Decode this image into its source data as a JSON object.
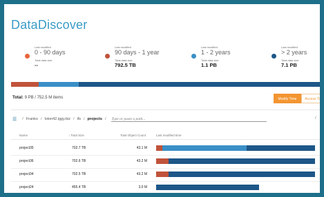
{
  "app": {
    "title": "DataDiscover"
  },
  "colors": {
    "age_0_90": "#e9653b",
    "age_90_1y": "#c0533b",
    "age_1_2y": "#3a8fc7",
    "age_gt2y": "#1d5688",
    "accent": "#f39531"
  },
  "stats": [
    {
      "caption": "Last modified",
      "range": "0 - 90 days",
      "size_caption": "Total data size",
      "size": "--"
    },
    {
      "caption": "Last modified",
      "range": "90 days - 1 year",
      "size_caption": "Total data size",
      "size": "792.5 TB"
    },
    {
      "caption": "Last modified",
      "range": "1 - 2 years",
      "size_caption": "Total data size",
      "size": "1.1 PB"
    },
    {
      "caption": "Last modified",
      "range": "> 2 years",
      "size_caption": "Total data size",
      "size": "7.1 PB"
    }
  ],
  "overall_distribution": [
    0.087,
    0.126,
    0.787
  ],
  "summary": {
    "total_label": "Total:",
    "total_value": "9 PB / 752.5 M items"
  },
  "toggle": {
    "modify_time": "Modify Time",
    "access_time": "Access Time"
  },
  "breadcrumb": {
    "items": [
      "Franko",
      "lolon42.iggy.biz",
      "ifs",
      "projects"
    ],
    "separator": "/",
    "path_placeholder": "Type or paste a path...",
    "trailing_slash": "/",
    "more": "⋮"
  },
  "table": {
    "headers": {
      "name": "Name",
      "total_size": "Total Size",
      "object_count": "Total Object Count",
      "last_modified": "Last modified time"
    },
    "sort_icon": "↓",
    "rows": [
      {
        "name": "project35",
        "total_size": "702.7 TB",
        "object_count": "43.1 M",
        "distribution": [
          0.04,
          0.53,
          0.43
        ],
        "bar_scale": 1.0
      },
      {
        "name": "project36",
        "total_size": "702.6 TB",
        "object_count": "43.2 M",
        "distribution": [
          0.08,
          0.0,
          0.92
        ],
        "bar_scale": 1.0
      },
      {
        "name": "project34",
        "total_size": "702.5 TB",
        "object_count": "43.2 M",
        "distribution": [
          0.08,
          0.0,
          0.92
        ],
        "bar_scale": 1.0
      },
      {
        "name": "project24",
        "total_size": "455.4 TB",
        "object_count": "3.0 M",
        "distribution": [
          0.0,
          0.0,
          1.0
        ],
        "bar_scale": 0.648
      }
    ]
  }
}
